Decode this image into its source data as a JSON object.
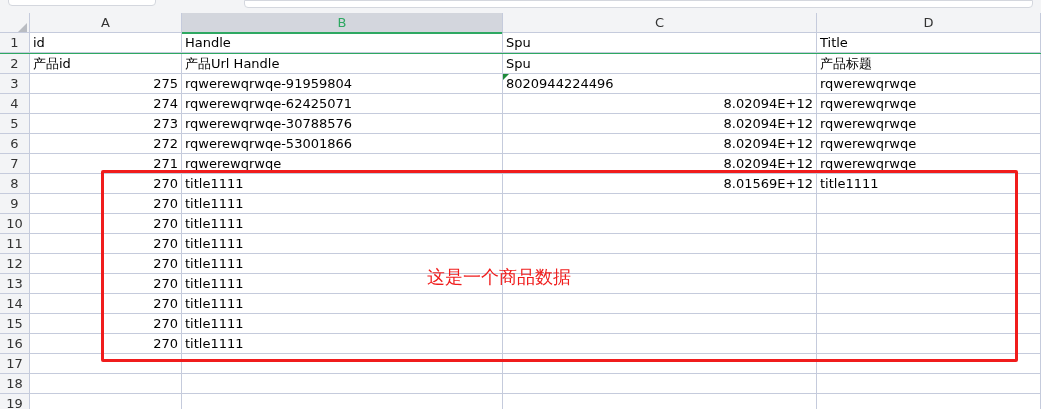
{
  "columns": [
    {
      "label": "A",
      "selected": false
    },
    {
      "label": "B",
      "selected": true
    },
    {
      "label": "C",
      "selected": false
    },
    {
      "label": "D",
      "selected": false
    }
  ],
  "rows": [
    {
      "number": "1",
      "cells": [
        {
          "text": "id",
          "kind": "text",
          "flagged": false
        },
        {
          "text": "Handle",
          "kind": "text",
          "flagged": false
        },
        {
          "text": "Spu",
          "kind": "text",
          "flagged": false
        },
        {
          "text": "Title",
          "kind": "text",
          "flagged": false
        }
      ]
    },
    {
      "number": "2",
      "cells": [
        {
          "text": "产品id",
          "kind": "text",
          "flagged": false
        },
        {
          "text": "产品Url Handle",
          "kind": "text",
          "flagged": false
        },
        {
          "text": "Spu",
          "kind": "text",
          "flagged": false
        },
        {
          "text": "产品标题",
          "kind": "text",
          "flagged": false
        }
      ]
    },
    {
      "number": "3",
      "cells": [
        {
          "text": "275",
          "kind": "number",
          "flagged": false
        },
        {
          "text": "rqwerewqrwqe-91959804",
          "kind": "text",
          "flagged": false
        },
        {
          "text": "8020944224496",
          "kind": "text",
          "flagged": true
        },
        {
          "text": "rqwerewqrwqe",
          "kind": "text",
          "flagged": false
        }
      ]
    },
    {
      "number": "4",
      "cells": [
        {
          "text": "274",
          "kind": "number",
          "flagged": false
        },
        {
          "text": "rqwerewqrwqe-62425071",
          "kind": "text",
          "flagged": false
        },
        {
          "text": "8.02094E+12",
          "kind": "number",
          "flagged": false
        },
        {
          "text": "rqwerewqrwqe",
          "kind": "text",
          "flagged": false
        }
      ]
    },
    {
      "number": "5",
      "cells": [
        {
          "text": "273",
          "kind": "number",
          "flagged": false
        },
        {
          "text": "rqwerewqrwqe-30788576",
          "kind": "text",
          "flagged": false
        },
        {
          "text": "8.02094E+12",
          "kind": "number",
          "flagged": false
        },
        {
          "text": "rqwerewqrwqe",
          "kind": "text",
          "flagged": false
        }
      ]
    },
    {
      "number": "6",
      "cells": [
        {
          "text": "272",
          "kind": "number",
          "flagged": false
        },
        {
          "text": "rqwerewqrwqe-53001866",
          "kind": "text",
          "flagged": false
        },
        {
          "text": "8.02094E+12",
          "kind": "number",
          "flagged": false
        },
        {
          "text": "rqwerewqrwqe",
          "kind": "text",
          "flagged": false
        }
      ]
    },
    {
      "number": "7",
      "cells": [
        {
          "text": "271",
          "kind": "number",
          "flagged": false
        },
        {
          "text": "rqwerewqrwqe",
          "kind": "text",
          "flagged": false
        },
        {
          "text": "8.02094E+12",
          "kind": "number",
          "flagged": false
        },
        {
          "text": "rqwerewqrwqe",
          "kind": "text",
          "flagged": false
        }
      ]
    },
    {
      "number": "8",
      "cells": [
        {
          "text": "270",
          "kind": "number",
          "flagged": false
        },
        {
          "text": "title1111",
          "kind": "text",
          "flagged": false
        },
        {
          "text": "8.01569E+12",
          "kind": "number",
          "flagged": false
        },
        {
          "text": "title1111",
          "kind": "text",
          "flagged": false
        }
      ]
    },
    {
      "number": "9",
      "cells": [
        {
          "text": "270",
          "kind": "number",
          "flagged": false
        },
        {
          "text": "title1111",
          "kind": "text",
          "flagged": false
        },
        null,
        null
      ]
    },
    {
      "number": "10",
      "cells": [
        {
          "text": "270",
          "kind": "number",
          "flagged": false
        },
        {
          "text": "title1111",
          "kind": "text",
          "flagged": false
        },
        null,
        null
      ]
    },
    {
      "number": "11",
      "cells": [
        {
          "text": "270",
          "kind": "number",
          "flagged": false
        },
        {
          "text": "title1111",
          "kind": "text",
          "flagged": false
        },
        null,
        null
      ]
    },
    {
      "number": "12",
      "cells": [
        {
          "text": "270",
          "kind": "number",
          "flagged": false
        },
        {
          "text": "title1111",
          "kind": "text",
          "flagged": false
        },
        null,
        null
      ]
    },
    {
      "number": "13",
      "cells": [
        {
          "text": "270",
          "kind": "number",
          "flagged": false
        },
        {
          "text": "title1111",
          "kind": "text",
          "flagged": false
        },
        null,
        null
      ]
    },
    {
      "number": "14",
      "cells": [
        {
          "text": "270",
          "kind": "number",
          "flagged": false
        },
        {
          "text": "title1111",
          "kind": "text",
          "flagged": false
        },
        null,
        null
      ]
    },
    {
      "number": "15",
      "cells": [
        {
          "text": "270",
          "kind": "number",
          "flagged": false
        },
        {
          "text": "title1111",
          "kind": "text",
          "flagged": false
        },
        null,
        null
      ]
    },
    {
      "number": "16",
      "cells": [
        {
          "text": "270",
          "kind": "number",
          "flagged": false
        },
        {
          "text": "title1111",
          "kind": "text",
          "flagged": false
        },
        null,
        null
      ]
    },
    {
      "number": "17",
      "cells": [
        null,
        null,
        null,
        null
      ]
    },
    {
      "number": "18",
      "cells": [
        null,
        null,
        null,
        null
      ]
    },
    {
      "number": "19",
      "cells": [
        null,
        null,
        null,
        null
      ]
    }
  ],
  "annotation": {
    "text": "这是一个商品数据"
  }
}
